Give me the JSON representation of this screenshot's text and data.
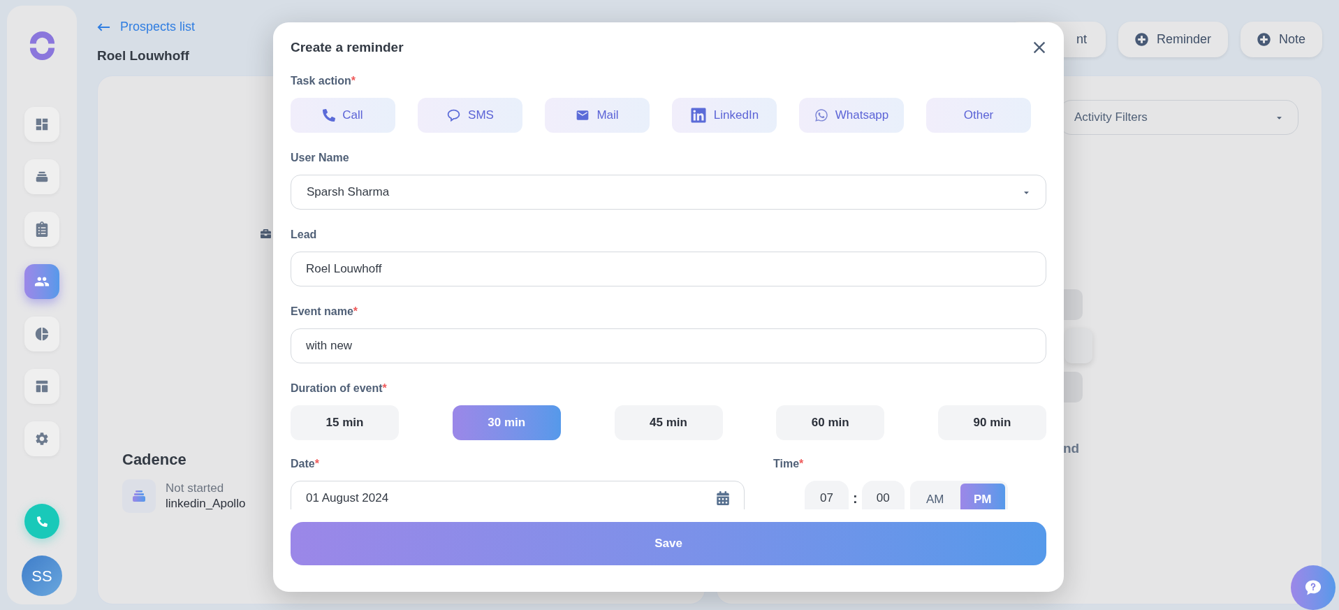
{
  "sidebar": {
    "items": [
      {
        "selected": false
      },
      {
        "selected": false
      },
      {
        "selected": false
      },
      {
        "selected": true
      },
      {
        "selected": false
      },
      {
        "selected": false
      },
      {
        "selected": false
      }
    ],
    "avatar": {
      "initials": "SS"
    }
  },
  "header": {
    "back_link": "Prospects list",
    "title": "Roel Louwhoff"
  },
  "top_actions": [
    {
      "label": "nt",
      "kind": "plain"
    },
    {
      "label": "Reminder",
      "kind": "add"
    },
    {
      "label": "Note",
      "kind": "add"
    }
  ],
  "cadence": {
    "title": "Cadence",
    "status": "Not started",
    "name": "linkedin_Apollo"
  },
  "activity_panel": {
    "filter": {
      "placeholder": "Activity Filters"
    },
    "partial_heading": "nd"
  },
  "modal": {
    "title": "Create a reminder",
    "task_action": {
      "label": "Task action",
      "mark": "*",
      "options": [
        {
          "label": "Call",
          "kind": "call"
        },
        {
          "label": "SMS",
          "kind": "sms"
        },
        {
          "label": "Mail",
          "kind": "mail"
        },
        {
          "label": "LinkedIn",
          "kind": "linkedin"
        },
        {
          "label": "Whatsapp",
          "kind": "whatsapp"
        },
        {
          "label": "Other",
          "kind": "other"
        }
      ]
    },
    "user_name": {
      "label": "User Name",
      "value": "Sparsh Sharma"
    },
    "lead": {
      "label": "Lead",
      "value": "Roel Louwhoff"
    },
    "event_name": {
      "label": "Event name",
      "mark": "*",
      "value": "with new"
    },
    "duration": {
      "label": "Duration of event",
      "mark": "*",
      "options": [
        {
          "label": "15 min",
          "selected": false
        },
        {
          "label": "30 min",
          "selected": true
        },
        {
          "label": "45 min",
          "selected": false
        },
        {
          "label": "60 min",
          "selected": false
        },
        {
          "label": "90 min",
          "selected": false
        }
      ]
    },
    "date": {
      "label": "Date",
      "mark": "*",
      "value": "01 August 2024"
    },
    "time": {
      "label": "Time",
      "mark": "*",
      "hour": "07",
      "separator": ":",
      "minute": "00",
      "meridiem": [
        {
          "label": "AM",
          "selected": false
        },
        {
          "label": "PM",
          "selected": true
        }
      ]
    },
    "save": "Save"
  }
}
